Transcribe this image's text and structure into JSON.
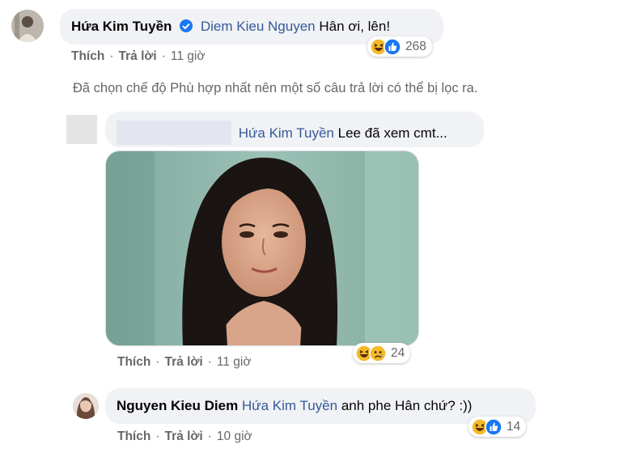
{
  "comment1": {
    "author": "Hứa Kim Tuyền",
    "mention": "Diem Kieu Nguyen",
    "text": "Hân ơi, lên!",
    "reaction_count": "268",
    "actions": {
      "like": "Thích",
      "reply": "Trả lời",
      "time": "11 giờ"
    }
  },
  "filter_notice": "Đã chọn chế độ Phù hợp nhất nên một số câu trả lời có thể bị lọc ra.",
  "reply1": {
    "mention": "Hứa Kim Tuyền",
    "text": "Lee đã xem cmt...",
    "reaction_count": "24",
    "actions": {
      "like": "Thích",
      "reply": "Trả lời",
      "time": "11 giờ"
    }
  },
  "reply2": {
    "author": "Nguyen Kieu Diem",
    "mention": "Hứa Kim Tuyền",
    "text": "anh phe Hân chứ? :))",
    "reaction_count": "14",
    "actions": {
      "like": "Thích",
      "reply": "Trả lời",
      "time": "10 giờ"
    }
  },
  "icons": {
    "verified": "verified-badge-icon",
    "haha": "haha-reaction-icon",
    "like": "like-reaction-icon",
    "sad": "sad-reaction-icon"
  },
  "colors": {
    "link": "#365899",
    "secondary_text": "#65676b",
    "bubble": "#f0f2f5",
    "like_blue": "#1877f2",
    "haha_yellow": "#f7b928"
  }
}
